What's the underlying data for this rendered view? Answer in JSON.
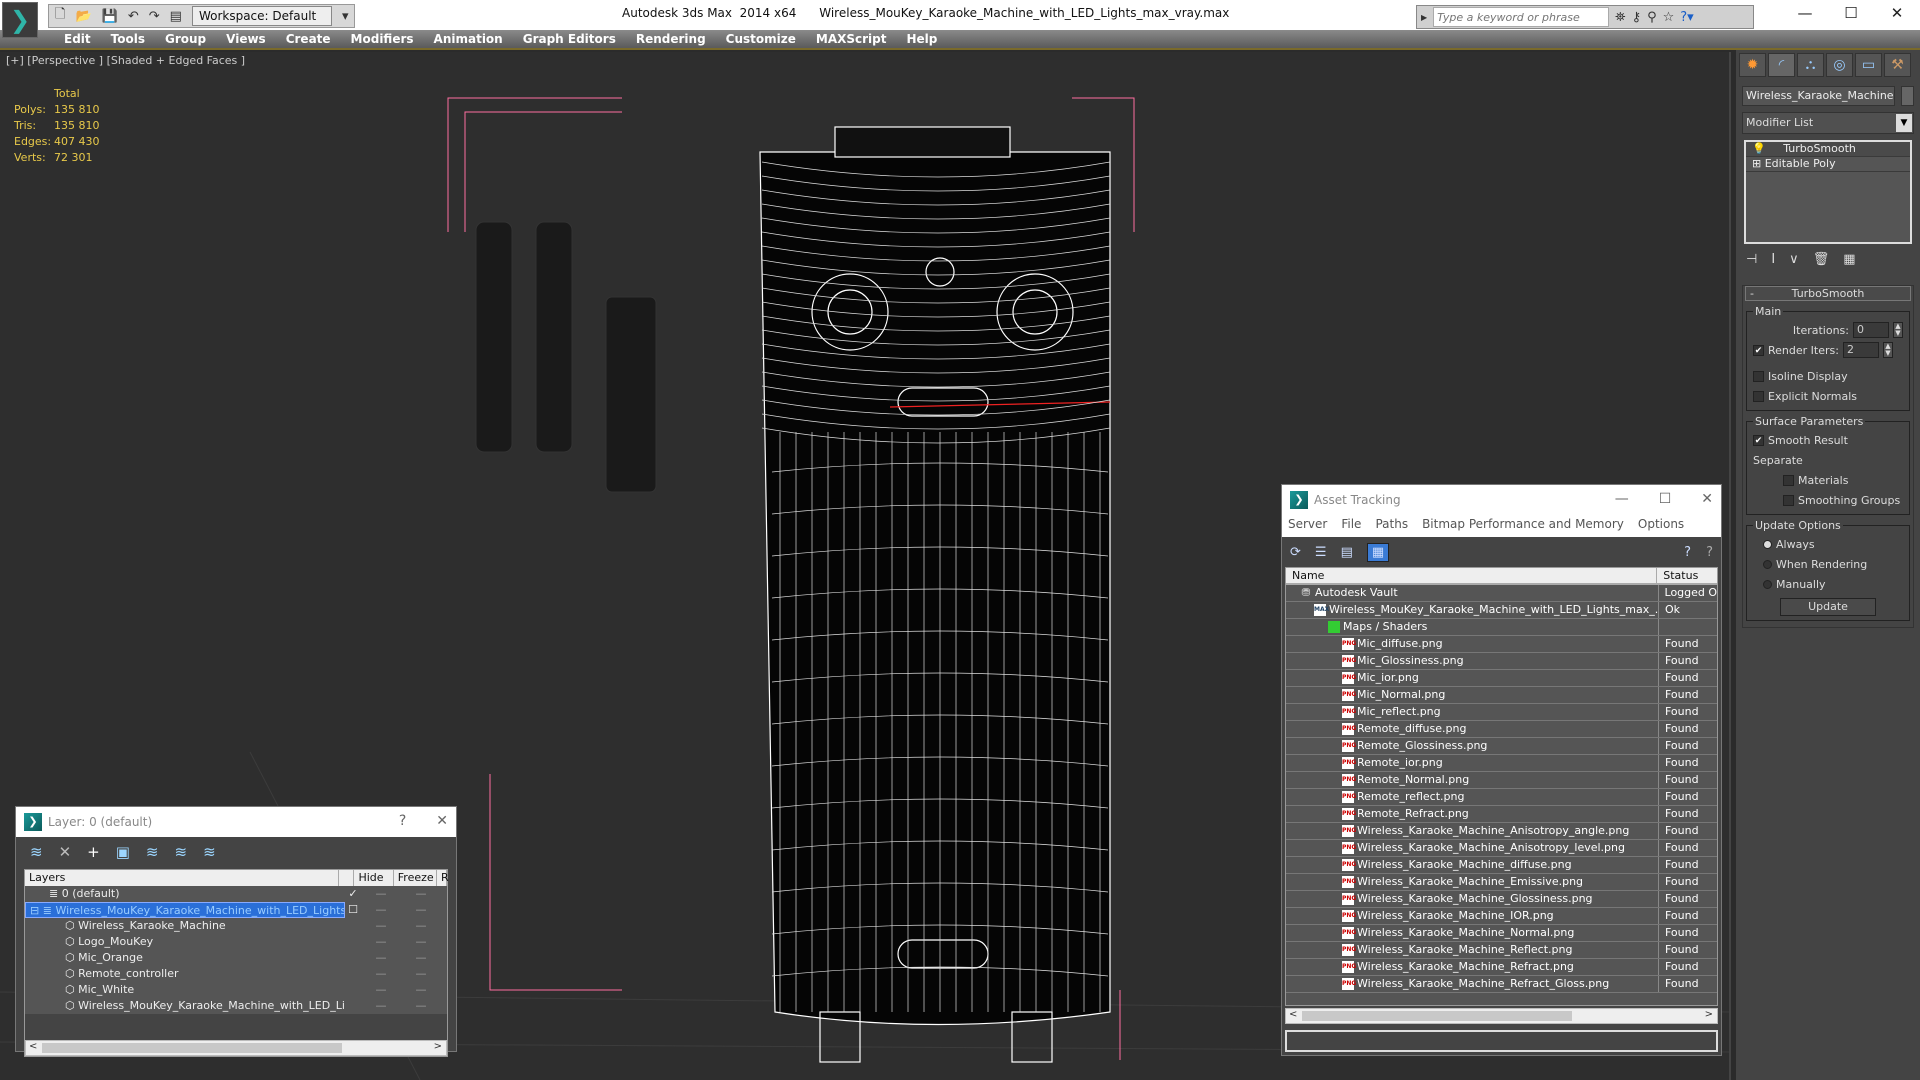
{
  "titlebar": {
    "app": "Autodesk 3ds Max  2014 x64",
    "file": "Wireless_MouKey_Karaoke_Machine_with_LED_Lights_max_vray.max",
    "workspace": "Workspace: Default",
    "search_placeholder": "Type a keyword or phrase"
  },
  "menu": [
    "Edit",
    "Tools",
    "Group",
    "Views",
    "Create",
    "Modifiers",
    "Animation",
    "Graph Editors",
    "Rendering",
    "Customize",
    "MAXScript",
    "Help"
  ],
  "viewport": {
    "label": "[+] [Perspective ] [Shaded + Edged Faces ]",
    "stats": {
      "header": "Total",
      "rows": [
        {
          "k": "Polys:",
          "v": "135 810"
        },
        {
          "k": "Tris:",
          "v": "135 810"
        },
        {
          "k": "Edges:",
          "v": "407 430"
        },
        {
          "k": "Verts:",
          "v": "72 301"
        }
      ]
    }
  },
  "command_panel": {
    "object_name": "Wireless_Karaoke_Machine",
    "modifier_list": "Modifier List",
    "stack": [
      "TurboSmooth",
      "Editable Poly"
    ],
    "rollout": {
      "title": "TurboSmooth",
      "main": "Main",
      "iterations_label": "Iterations:",
      "iterations": "0",
      "render_iters_label": "Render Iters:",
      "render_iters": "2",
      "render_iters_checked": true,
      "isoline": "Isoline Display",
      "explicit_normals": "Explicit Normals",
      "surface": "Surface Parameters",
      "smooth_result": "Smooth Result",
      "smooth_result_checked": true,
      "separate": "Separate",
      "materials": "Materials",
      "smoothing_groups": "Smoothing Groups",
      "update_options": "Update Options",
      "always": "Always",
      "when_rendering": "When Rendering",
      "manually": "Manually",
      "selected_option": "Always",
      "update": "Update"
    }
  },
  "asset_tracking": {
    "title": "Asset Tracking",
    "menu": [
      "Server",
      "File",
      "Paths",
      "Bitmap Performance and Memory",
      "Options"
    ],
    "col_name": "Name",
    "col_status": "Status",
    "rows": [
      {
        "name": "Autodesk Vault",
        "status": "Logged O",
        "level": 0,
        "icon": "vault"
      },
      {
        "name": "Wireless_MouKey_Karaoke_Machine_with_LED_Lights_max_...",
        "status": "Ok",
        "level": 1,
        "icon": "max"
      },
      {
        "name": "Maps / Shaders",
        "status": "",
        "level": 2,
        "icon": "maps"
      },
      {
        "name": "Mic_diffuse.png",
        "status": "Found"
      },
      {
        "name": "Mic_Glossiness.png",
        "status": "Found"
      },
      {
        "name": "Mic_ior.png",
        "status": "Found"
      },
      {
        "name": "Mic_Normal.png",
        "status": "Found"
      },
      {
        "name": "Mic_reflect.png",
        "status": "Found"
      },
      {
        "name": "Remote_diffuse.png",
        "status": "Found"
      },
      {
        "name": "Remote_Glossiness.png",
        "status": "Found"
      },
      {
        "name": "Remote_ior.png",
        "status": "Found"
      },
      {
        "name": "Remote_Normal.png",
        "status": "Found"
      },
      {
        "name": "Remote_reflect.png",
        "status": "Found"
      },
      {
        "name": "Remote_Refract.png",
        "status": "Found"
      },
      {
        "name": "Wireless_Karaoke_Machine_Anisotropy_angle.png",
        "status": "Found"
      },
      {
        "name": "Wireless_Karaoke_Machine_Anisotropy_level.png",
        "status": "Found"
      },
      {
        "name": "Wireless_Karaoke_Machine_diffuse.png",
        "status": "Found"
      },
      {
        "name": "Wireless_Karaoke_Machine_Emissive.png",
        "status": "Found"
      },
      {
        "name": "Wireless_Karaoke_Machine_Glossiness.png",
        "status": "Found"
      },
      {
        "name": "Wireless_Karaoke_Machine_IOR.png",
        "status": "Found"
      },
      {
        "name": "Wireless_Karaoke_Machine_Normal.png",
        "status": "Found"
      },
      {
        "name": "Wireless_Karaoke_Machine_Reflect.png",
        "status": "Found"
      },
      {
        "name": "Wireless_Karaoke_Machine_Refract.png",
        "status": "Found"
      },
      {
        "name": "Wireless_Karaoke_Machine_Refract_Gloss.png",
        "status": "Found"
      }
    ]
  },
  "layers": {
    "title": "Layer: 0 (default)",
    "col_layers": "Layers",
    "col_hide": "Hide",
    "col_freeze": "Freeze",
    "col_r": "R",
    "rows": [
      {
        "name": "0 (default)",
        "level": 0,
        "current": true
      },
      {
        "name": "Wireless_MouKey_Karaoke_Machine_with_LED_Lights",
        "level": 0,
        "selected": true
      },
      {
        "name": "Wireless_Karaoke_Machine",
        "level": 1
      },
      {
        "name": "Logo_MouKey",
        "level": 1
      },
      {
        "name": "Mic_Orange",
        "level": 1
      },
      {
        "name": "Remote_controller",
        "level": 1
      },
      {
        "name": "Mic_White",
        "level": 1
      },
      {
        "name": "Wireless_MouKey_Karaoke_Machine_with_LED_Lights",
        "level": 1
      }
    ]
  },
  "colors": {
    "stats": "#e8c94a",
    "selection": "#2a6fd8",
    "bbox": "#ff6fa0",
    "wire": "#ffffff"
  }
}
